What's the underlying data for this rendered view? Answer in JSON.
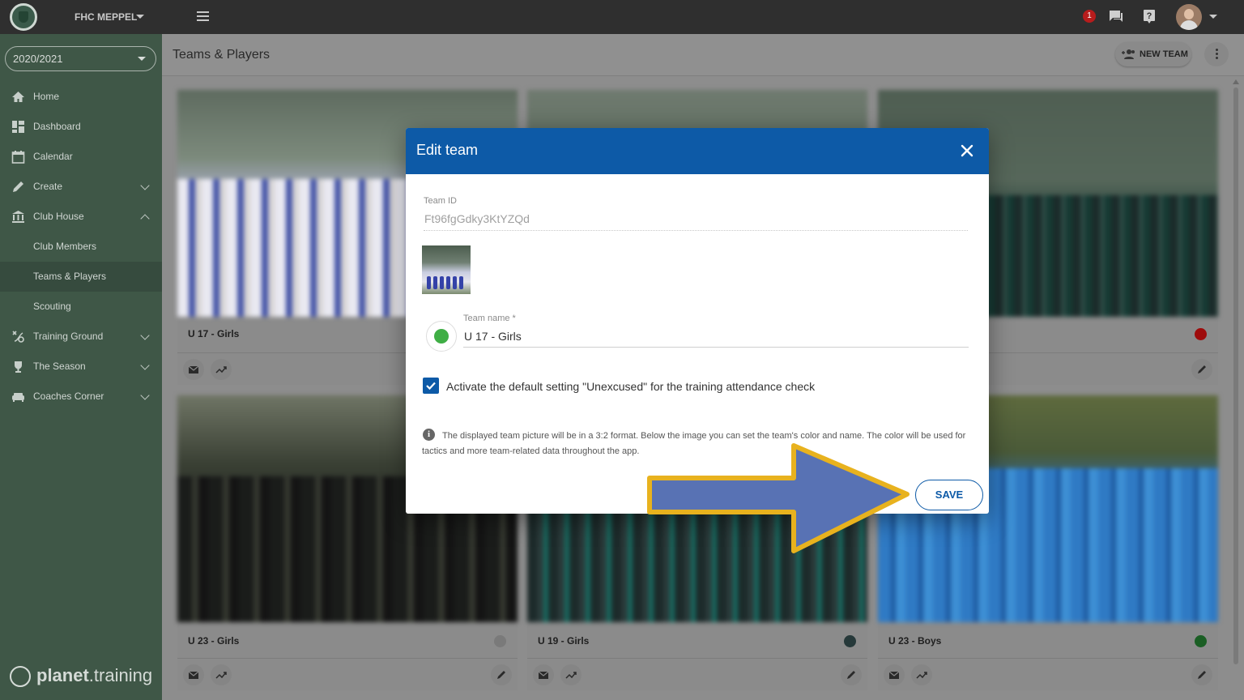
{
  "topbar": {
    "club_name": "FHC MEPPEL",
    "notification_count": "1"
  },
  "sidebar": {
    "season": "2020/2021",
    "items": [
      {
        "label": "Home",
        "icon": "home-icon"
      },
      {
        "label": "Dashboard",
        "icon": "dashboard-icon"
      },
      {
        "label": "Calendar",
        "icon": "calendar-icon"
      },
      {
        "label": "Create",
        "icon": "pencil-icon"
      },
      {
        "label": "Club House",
        "icon": "bank-icon"
      },
      {
        "label": "Club Members"
      },
      {
        "label": "Teams & Players"
      },
      {
        "label": "Scouting"
      },
      {
        "label": "Training Ground",
        "icon": "tactics-icon"
      },
      {
        "label": "The Season",
        "icon": "trophy-icon"
      },
      {
        "label": "Coaches Corner",
        "icon": "couch-icon"
      }
    ],
    "brand_bold": "planet",
    "brand_light": ".training"
  },
  "header": {
    "title": "Teams & Players",
    "new_team_label": "NEW TEAM"
  },
  "teams": [
    {
      "name": "U 17 - Girls",
      "color": ""
    },
    {
      "name": "",
      "color": ""
    },
    {
      "name": "",
      "color": "#9e0b0b"
    },
    {
      "name": "U 23 - Girls",
      "color": "#7a7a7a"
    },
    {
      "name": "U 19 - Girls",
      "color": "#26393a"
    },
    {
      "name": "U 23 - Boys",
      "color": "#1a5e24"
    }
  ],
  "modal": {
    "title": "Edit team",
    "team_id_label": "Team ID",
    "team_id_value": "Ft96fgGdky3KtYZQd",
    "team_name_label": "Team name *",
    "team_name_value": "U 17 - Girls",
    "team_color": "#3fae45",
    "checkbox_label": "Activate the default setting \"Unexcused\" for the training attendance check",
    "checkbox_checked": true,
    "info_text": "The displayed team picture will be in a 3:2 format. Below the image you can set the team's color and name. The color will be used for tactics and more team-related data throughout the app.",
    "save_label": "SAVE"
  },
  "colors": {
    "accent": "#0d5aa7",
    "sidebar_bg": "#3f5747",
    "topbar_bg": "#2f2f2f",
    "arrow_fill": "#5872b4",
    "arrow_border": "#e8b21e"
  }
}
